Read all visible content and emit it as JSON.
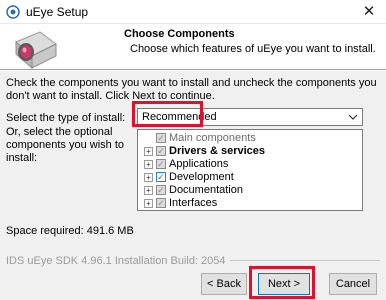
{
  "window": {
    "title": "uEye Setup",
    "close_glyph": "✕",
    "app_icon": "ueye-icon"
  },
  "header": {
    "title": "Choose Components",
    "subtitle": "Choose which features of uEye you want to install.",
    "logo": "camera-logo"
  },
  "instructions": "Check the components you want to install and uncheck the components you don't want to install. Click Next to continue.",
  "install_type": {
    "label": "Select the type of install:",
    "value": "Recommended"
  },
  "components": {
    "label": "Or, select the optional components you wish to install:",
    "items": [
      {
        "label": "Main components",
        "expandable": false,
        "check": "grayed",
        "bold": false,
        "glyph": "✓"
      },
      {
        "label": "Drivers & services",
        "expandable": true,
        "check": "grayed",
        "bold": true,
        "glyph": "✓"
      },
      {
        "label": "Applications",
        "expandable": true,
        "check": "grayed",
        "bold": false,
        "glyph": "✓"
      },
      {
        "label": "Development",
        "expandable": true,
        "check": "checked",
        "bold": false,
        "glyph": "✓"
      },
      {
        "label": "Documentation",
        "expandable": true,
        "check": "grayed",
        "bold": false,
        "glyph": "✓"
      },
      {
        "label": "Interfaces",
        "expandable": true,
        "check": "grayed",
        "bold": false,
        "glyph": "✓"
      }
    ],
    "expander_glyph": "+"
  },
  "space_required": "Space required: 491.6 MB",
  "footer": "IDS uEye SDK 4.96.1 Installation Build: 2054",
  "buttons": {
    "back": "< Back",
    "next": "Next >",
    "cancel": "Cancel"
  },
  "colors": {
    "highlight": "#e0112c",
    "panel": "#f0f0f0",
    "check_green": "#1a9a1a"
  }
}
